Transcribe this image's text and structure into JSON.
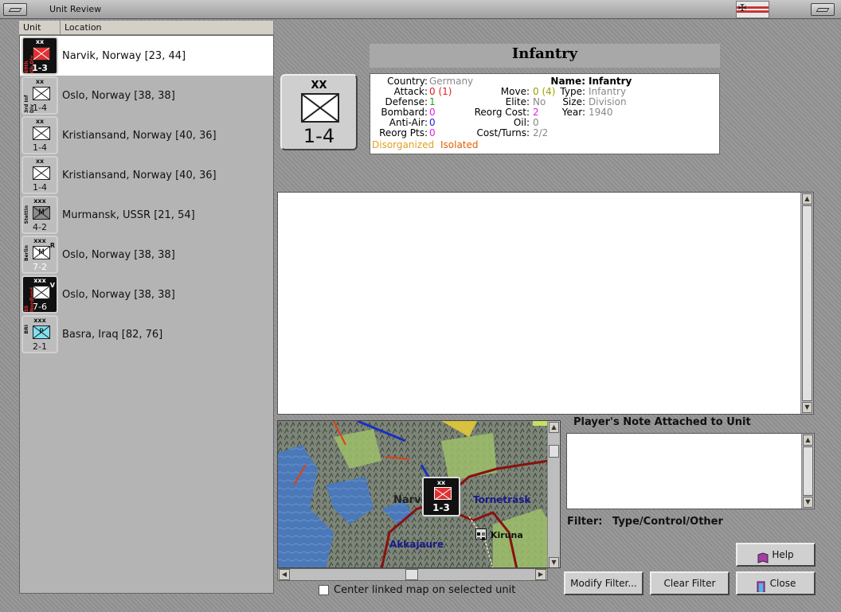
{
  "window": {
    "title": "Unit Review"
  },
  "columns": {
    "unit": "Unit",
    "location": "Location"
  },
  "units": [
    {
      "size": "xx",
      "value": "1-3",
      "location": "Narvik, Norway [23, 44]",
      "side": "69th Gb.Div",
      "selected": true,
      "bg": "#111111",
      "box_color": "#e03030",
      "value_color": "#ffffff"
    },
    {
      "size": "xx",
      "value": "1-4",
      "location": "Oslo, Norway [38, 38]",
      "side": "3rd Inf Div",
      "selected": false,
      "bg": "#bdbdbd",
      "box_color": "#ffffff",
      "value_color": "#111111"
    },
    {
      "size": "xx",
      "value": "1-4",
      "location": "Kristiansand, Norway [40, 36]",
      "side": "",
      "selected": false,
      "bg": "#bdbdbd",
      "box_color": "#ffffff",
      "value_color": "#111111"
    },
    {
      "size": "xx",
      "value": "1-4",
      "location": "Kristiansand, Norway [40, 36]",
      "side": "",
      "selected": false,
      "bg": "#bdbdbd",
      "box_color": "#ffffff",
      "value_color": "#111111"
    },
    {
      "size": "xxx",
      "value": "4-2",
      "location": "Murmansk, USSR [21, 54]",
      "side": "Stettin",
      "selected": false,
      "bg": "#bdbdbd",
      "box_color": "#8a8a8a",
      "value_color": "#111111",
      "letter": "M"
    },
    {
      "size": "xxx",
      "value": "7-2",
      "location": "Oslo, Norway [38, 38]",
      "side": "Berlin",
      "selected": false,
      "bg": "#bdbdbd",
      "box_color": "#ffffff",
      "value_color": "#ffffff",
      "letter": "M",
      "tag": "R"
    },
    {
      "size": "xxx",
      "value": "7-6",
      "location": "Oslo, Norway [38, 38]",
      "side": "SS Nordland",
      "selected": false,
      "bg": "#111111",
      "box_color": "#ffffff",
      "value_color": "#ffffff",
      "tag": "V"
    },
    {
      "size": "xxx",
      "value": "2-1",
      "location": "Basra, Iraq [82, 76]",
      "side": "BRI",
      "selected": false,
      "bg": "#bdbdbd",
      "box_color": "#7fe0f0",
      "value_color": "#111111",
      "letter": "P"
    }
  ],
  "detail": {
    "title": "Infantry",
    "counter": {
      "size": "XX",
      "value": "1-4"
    },
    "stats": {
      "country_label": "Country:",
      "country": "Germany",
      "attack_label": "Attack:",
      "attack": "0 (1)",
      "defense_label": "Defense:",
      "defense": "1",
      "bombard_label": "Bombard:",
      "bombard": "0",
      "antiair_label": "Anti-Air:",
      "antiair": "0",
      "reorgpts_label": "Reorg Pts:",
      "reorgpts": "0",
      "move_label": "Move:",
      "move": "0 (4)",
      "elite_label": "Elite:",
      "elite": "No",
      "reorgcost_label": "Reorg Cost:",
      "reorgcost": "2",
      "oil_label": "Oil:",
      "oil": "0",
      "costturns_label": "Cost/Turns:",
      "costturns": "2/2",
      "name_label": "Name:",
      "name": "Infantry",
      "type_label": "Type:",
      "type": "Infantry",
      "size_label": "Size:",
      "size": "Division",
      "year_label": "Year:",
      "year": "1940",
      "status1": "Disorganized",
      "status2": "Isolated"
    }
  },
  "map": {
    "labels": {
      "narvik": "Narvik",
      "tornetrask": "Torneträsk",
      "kiruna": "Kiruna",
      "akkajaure": "Akkajaure"
    },
    "unit_value": "1-3",
    "unit_size": "xx"
  },
  "center_map_label": "Center linked map on selected unit",
  "note_heading": "Player's Note Attached to Unit",
  "filter": {
    "label": "Filter:",
    "value": "Type/Control/Other"
  },
  "buttons": {
    "help": "Help",
    "modify_filter": "Modify Filter...",
    "clear_filter": "Clear Filter",
    "close": "Close"
  }
}
